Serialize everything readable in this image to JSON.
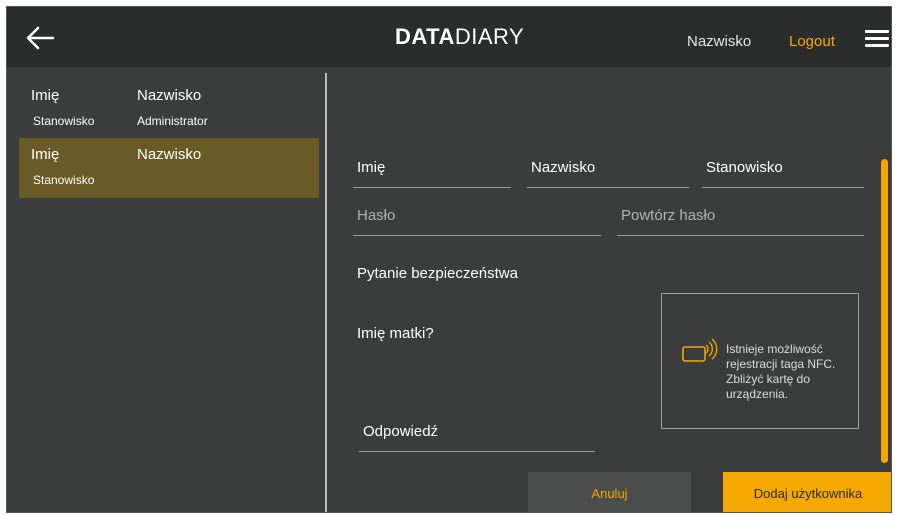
{
  "header": {
    "logo_bold": "DATA",
    "logo_light": "DIARY",
    "user_name": "Nazwisko",
    "logout_label": "Logout"
  },
  "sidebar": {
    "users": [
      {
        "first": "Imię",
        "last": "Nazwisko",
        "position": "Stanowisko",
        "role": "Administrator",
        "selected": false
      },
      {
        "first": "Imię",
        "last": "Nazwisko",
        "position": "Stanowisko",
        "role": "",
        "selected": true
      }
    ]
  },
  "form": {
    "first_name_label": "Imię",
    "last_name_label": "Nazwisko",
    "position_label": "Stanowisko",
    "password_placeholder": "Hasło",
    "repeat_password_placeholder": "Powtórz hasło",
    "security_question_label": "Pytanie bezpieczeństwa",
    "security_question_value": "Imię matki?",
    "answer_label": "Odpowiedź",
    "nfc_info": "Istnieje możliwość rejestracji taga NFC. Zbliżyć kartę do urządzenia."
  },
  "buttons": {
    "cancel": "Anuluj",
    "add_user": "Dodaj użytkownika"
  },
  "colors": {
    "accent": "#f5a800",
    "header_bg": "#2b2c2c",
    "panel_bg": "#3b3c3c",
    "selected_row": "#6a5a25"
  },
  "icons": [
    "back-arrow-icon",
    "hamburger-menu-icon",
    "nfc-card-icon"
  ]
}
